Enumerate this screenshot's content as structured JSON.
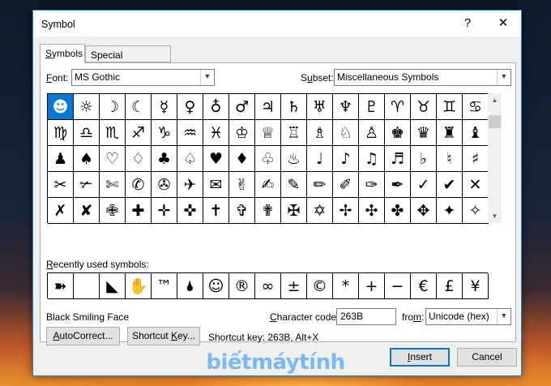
{
  "dialog": {
    "title": "Symbol",
    "help_btn": "?",
    "close_btn": "✕"
  },
  "tabs": [
    {
      "label": "Symbols",
      "access_key": "S",
      "active": true
    },
    {
      "label": "Special Characters",
      "access_key": "P",
      "active": false
    }
  ],
  "font": {
    "label": "Font:",
    "access_key": "F",
    "value": "MS Gothic"
  },
  "subset": {
    "label": "Subset:",
    "access_key": "u",
    "value": "Miscellaneous Symbols"
  },
  "symbols": {
    "selected_index": 0,
    "cells": [
      [
        "☻",
        "☼",
        "☽",
        "☾",
        "☿",
        "♀",
        "♁",
        "♂",
        "♃",
        "♄",
        "♅",
        "♆",
        "♇",
        "♈",
        "♉",
        "♊",
        "♋"
      ],
      [
        "♍",
        "♎",
        "♏",
        "♐",
        "♑",
        "♒",
        "♓",
        "♔",
        "♕",
        "♖",
        "♗",
        "♘",
        "♙",
        "♚",
        "♛",
        "♜",
        "♝"
      ],
      [
        "♟",
        "♠",
        "♡",
        "♢",
        "♣",
        "♤",
        "♥",
        "♦",
        "♧",
        "♨",
        "♩",
        "♪",
        "♫",
        "♬",
        "♭",
        "♮",
        "♯"
      ],
      [
        "✂",
        "✃",
        "✄",
        "✆",
        "✇",
        "✈",
        "✉",
        "✌",
        "✍",
        "✎",
        "✏",
        "✐",
        "✑",
        "✒",
        "✓",
        "✔",
        "✕"
      ],
      [
        "✗",
        "✘",
        "✙",
        "✚",
        "✛",
        "✜",
        "✝",
        "✞",
        "✟",
        "✠",
        "✡",
        "✢",
        "✣",
        "✤",
        "✥",
        "✦",
        "✧"
      ]
    ]
  },
  "recently_used": {
    "label": "Recently used symbols:",
    "access_key": "R",
    "items": [
      "➽",
      " ",
      "◣",
      "✋",
      "™",
      "🌢",
      "☺",
      "®",
      "∞",
      "±",
      "©",
      "*",
      "+",
      "−",
      "€",
      "£",
      "¥",
      "®"
    ]
  },
  "char_name": "Black Smiling Face",
  "char_code": {
    "label": "Character code:",
    "access_key": "C",
    "value": "263B"
  },
  "from": {
    "label": "from:",
    "access_key": "m",
    "value": "Unicode (hex)"
  },
  "buttons": {
    "autocorrect": "AutoCorrect...",
    "autocorrect_key": "A",
    "shortcut_key": "Shortcut Key...",
    "shortcut_key_key": "K",
    "insert": "Insert",
    "insert_key": "I",
    "cancel": "Cancel"
  },
  "shortcut_info": "Shortcut key: 263B, Alt+X",
  "watermark": "biếtmáytính",
  "colors": {
    "accent": "#0078d7",
    "window_border": "#1883d7",
    "watermark": "#6eb4ff"
  }
}
